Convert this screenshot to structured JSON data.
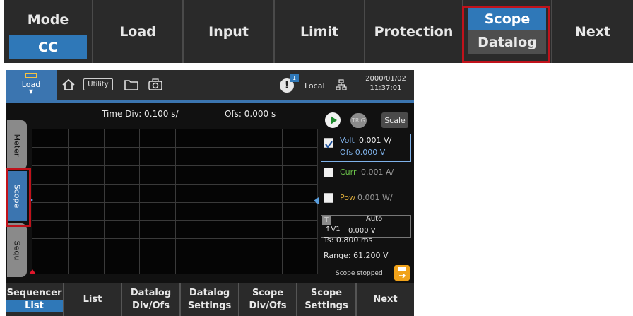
{
  "top_softkeys": {
    "mode": {
      "label": "Mode",
      "value": "CC"
    },
    "load": "Load",
    "input": "Input",
    "limit": "Limit",
    "protection": "Protection",
    "scope": {
      "top": "Scope",
      "bottom": "Datalog"
    },
    "next": "Next"
  },
  "status_bar": {
    "load_label": "Load",
    "utility_label": "Utility",
    "remote_badge": "1",
    "local_label": "Local",
    "date": "2000/01/02",
    "time": "11:37:01",
    "icons": [
      "home-icon",
      "folder-icon",
      "camera-icon",
      "network-icon"
    ]
  },
  "side_tabs": [
    "Meter",
    "Scope",
    "Sequ"
  ],
  "scope": {
    "time_div": "Time Div: 0.100 s/",
    "offset": "Ofs: 0.000 s",
    "trig_label": "TRIG",
    "scale_label": "Scale",
    "volt": {
      "name": "Volt",
      "div": "0.001 V/",
      "ofs": "Ofs 0.000 V",
      "checked": true,
      "color": "#7fb2ea"
    },
    "curr": {
      "name": "Curr",
      "div": "0.001 A/",
      "checked": false,
      "color": "#6bc24a"
    },
    "pow": {
      "name": "Pow",
      "div": "0.001 W/",
      "checked": false,
      "color": "#d9a93a"
    },
    "trigger": {
      "t_label": "T",
      "mode": "Auto",
      "source": "↑V1",
      "level": "0.000 V"
    },
    "ts": "Ts: 0.800 ms",
    "range": "Range: 61.200 V",
    "state": "Scope stopped"
  },
  "bottom_softkeys": [
    {
      "top": "Sequencer",
      "bottom": "List"
    },
    {
      "top": "List",
      "bottom": ""
    },
    {
      "top": "Datalog",
      "bottom": "Div/Ofs"
    },
    {
      "top": "Datalog",
      "bottom": "Settings"
    },
    {
      "top": "Scope",
      "bottom": "Div/Ofs"
    },
    {
      "top": "Scope",
      "bottom": "Settings"
    },
    {
      "top": "Next",
      "bottom": ""
    }
  ],
  "colors": {
    "accent": "#2f78b8",
    "highlight": "#c0121b"
  }
}
